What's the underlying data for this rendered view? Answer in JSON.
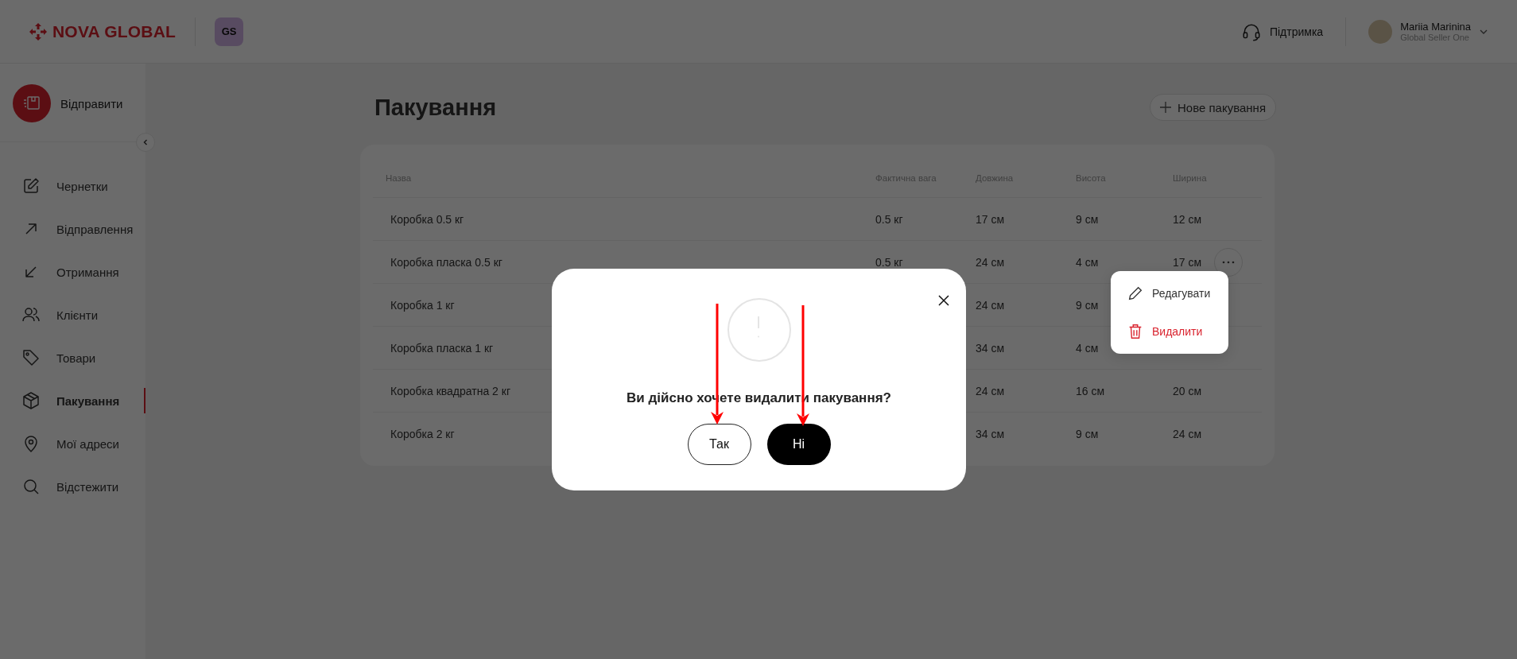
{
  "header": {
    "logo": "NOVA GLOBAL",
    "badge": "GS",
    "support": "Підтримка",
    "user": {
      "name": "Mariia Marinina",
      "role": "Global Seller One"
    }
  },
  "sidebar": {
    "send_button": "Відправити",
    "items": [
      {
        "label": "Чернетки",
        "selected": false
      },
      {
        "label": "Відправлення",
        "selected": false
      },
      {
        "label": "Отримання",
        "selected": false
      },
      {
        "label": "Клієнти",
        "selected": false
      },
      {
        "label": "Товари",
        "selected": false
      },
      {
        "label": "Пакування",
        "selected": true
      },
      {
        "label": "Мої адреси",
        "selected": false
      },
      {
        "label": "Відстежити",
        "selected": false
      }
    ]
  },
  "page": {
    "title": "Пакування",
    "new_button": "Нове пакування"
  },
  "table": {
    "columns": [
      "Назва",
      "Фактична вага",
      "Довжина",
      "Висота",
      "Ширина"
    ],
    "rows": [
      {
        "name": "Коробка 0.5 кг",
        "weight": "0.5 кг",
        "length": "17 см",
        "height": "9 см",
        "width": "12 см",
        "menu_open": false
      },
      {
        "name": "Коробка пласка 0.5 кг",
        "weight": "0.5 кг",
        "length": "24 см",
        "height": "4 см",
        "width": "17 см",
        "menu_open": true
      },
      {
        "name": "Коробка 1 кг",
        "length": "24 см",
        "height": "9 см",
        "menu_open": false
      },
      {
        "name": "Коробка пласка 1 кг",
        "length": "34 см",
        "height": "4 см",
        "menu_open": false
      },
      {
        "name": "Коробка квадратна 2 кг",
        "length": "24 см",
        "height": "16 см",
        "width": "20 см",
        "menu_open": false
      },
      {
        "name": "Коробка 2 кг",
        "length": "34 см",
        "height": "9 см",
        "width": "24 см",
        "menu_open": false
      }
    ],
    "row_menu": [
      {
        "label": "Редагувати",
        "kind": "edit"
      },
      {
        "label": "Видалити",
        "kind": "delete"
      }
    ]
  },
  "dialog": {
    "message": "Ви дійсно хочете видалити пакування?",
    "buttons": [
      {
        "label": "Так",
        "kind": "secondary"
      },
      {
        "label": "Ні",
        "kind": "primary"
      }
    ]
  }
}
